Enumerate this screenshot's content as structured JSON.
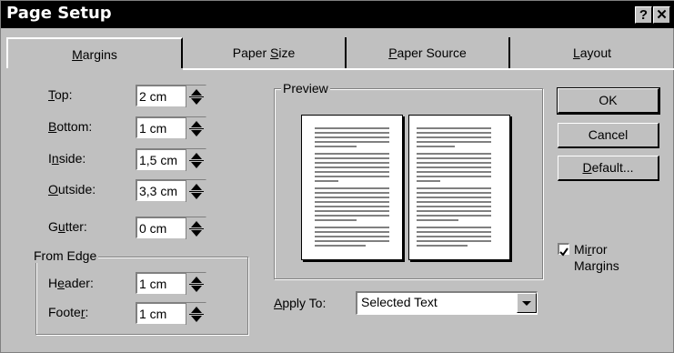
{
  "window": {
    "title": "Page Setup",
    "help_glyph": "?",
    "close_glyph": "✕",
    "help_icon": "help-icon",
    "close_icon": "close-icon"
  },
  "tabs": [
    {
      "label": "Margins",
      "accel": "M",
      "active": true
    },
    {
      "label": "Paper Size",
      "accel": "S"
    },
    {
      "label": "Paper Source",
      "accel": "P"
    },
    {
      "label": "Layout",
      "accel": "L"
    }
  ],
  "margins": {
    "top": {
      "label": "Top:",
      "value": "2 cm"
    },
    "bottom": {
      "label": "Bottom:",
      "value": "1 cm"
    },
    "inside": {
      "label": "Inside:",
      "value": "1,5 cm"
    },
    "outside": {
      "label": "Outside:",
      "value": "3,3 cm"
    },
    "gutter": {
      "label": "Gutter:",
      "value": "0 cm"
    }
  },
  "from_edge": {
    "title": "From Edge",
    "header": {
      "label": "Header:",
      "value": "1 cm"
    },
    "footer": {
      "label": "Footer:",
      "value": "1 cm"
    }
  },
  "preview": {
    "title": "Preview"
  },
  "apply_to": {
    "label": "Apply To:",
    "value": "Selected Text"
  },
  "buttons": {
    "ok": "OK",
    "cancel": "Cancel",
    "default": "Default..."
  },
  "mirror": {
    "label_line1": "Mirror",
    "label_line2": "Margins",
    "checked": true
  }
}
